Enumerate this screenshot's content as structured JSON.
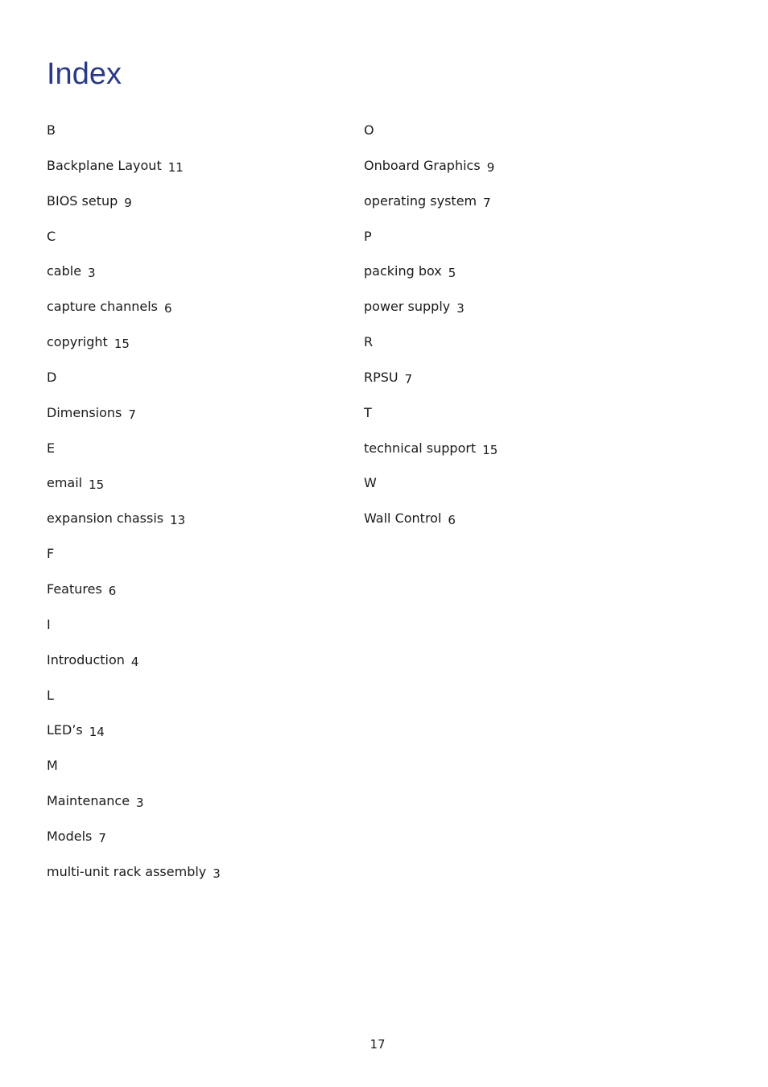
{
  "title": "Index",
  "left_column": [
    {
      "term": "B",
      "page": ""
    },
    {
      "term": "Backplane Layout",
      "page": "11"
    },
    {
      "term": "BIOS setup",
      "page": "9"
    },
    {
      "term": "C",
      "page": ""
    },
    {
      "term": "cable",
      "page": "3"
    },
    {
      "term": "capture channels",
      "page": "6"
    },
    {
      "term": "copyright",
      "page": "15"
    },
    {
      "term": "D",
      "page": ""
    },
    {
      "term": "Dimensions",
      "page": "7"
    },
    {
      "term": "E",
      "page": ""
    },
    {
      "term": "email",
      "page": "15"
    },
    {
      "term": "expansion chassis",
      "page": "13"
    },
    {
      "term": "F",
      "page": ""
    },
    {
      "term": "Features",
      "page": "6"
    },
    {
      "term": "I",
      "page": ""
    },
    {
      "term": "Introduction",
      "page": "4"
    },
    {
      "term": "L",
      "page": ""
    },
    {
      "term": "LED’s",
      "page": "14"
    },
    {
      "term": "M",
      "page": ""
    },
    {
      "term": "Maintenance",
      "page": "3"
    },
    {
      "term": "Models",
      "page": "7"
    },
    {
      "term": "multi-unit rack assembly",
      "page": "3"
    }
  ],
  "right_column": [
    {
      "term": "O",
      "page": ""
    },
    {
      "term": "Onboard Graphics",
      "page": "9"
    },
    {
      "term": "operating system",
      "page": "7"
    },
    {
      "term": "P",
      "page": ""
    },
    {
      "term": "packing box",
      "page": "5"
    },
    {
      "term": "power supply",
      "page": "3"
    },
    {
      "term": "R",
      "page": ""
    },
    {
      "term": "RPSU",
      "page": "7"
    },
    {
      "term": "T",
      "page": ""
    },
    {
      "term": "technical support",
      "page": "15"
    },
    {
      "term": "W",
      "page": ""
    },
    {
      "term": "Wall Control",
      "page": "6"
    }
  ],
  "page_number": "17"
}
